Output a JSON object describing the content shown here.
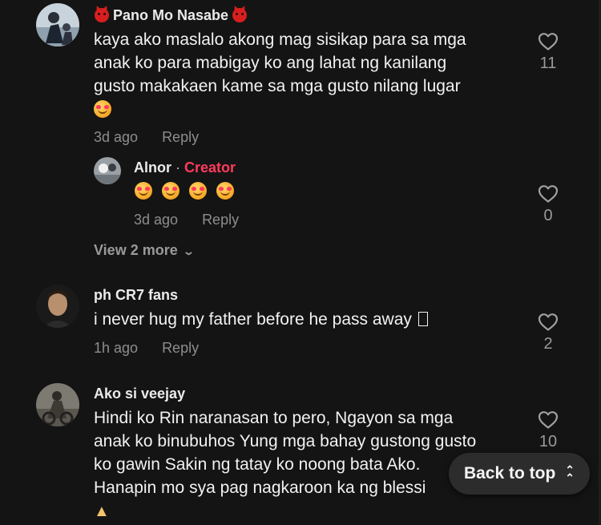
{
  "comments": [
    {
      "username": "Pano Mo Nasabe",
      "text_lines": [
        "kaya ako maslalo akong mag sisikap para sa mga",
        "anak ko para mabigay ko ang lahat ng kanilang",
        "gusto makakaen kame sa mga gusto nilang lugar"
      ],
      "emoji": "smiling-face-with-hearts",
      "time": "3d ago",
      "reply_label": "Reply",
      "likes": "11"
    },
    {
      "username": "Alnor",
      "creator_separator": "·",
      "creator_label": "Creator",
      "emoji": "smiling-face-with-hearts x4",
      "time": "3d ago",
      "reply_label": "Reply",
      "likes": "0"
    },
    {
      "username": "ph CR7 fans",
      "text": "i never hug my father before he pass away",
      "time": "1h ago",
      "reply_label": "Reply",
      "likes": "2"
    },
    {
      "username": "Ako si veejay",
      "text_lines": [
        "Hindi ko Rin naranasan to pero, Ngayon sa mga",
        "anak ko binubuhos Yung mga bahay gustong gusto",
        "ko gawin Sakin ng tatay ko noong bata Ako.",
        "Hanapin mo sya pag nagkaroon ka ng blessi"
      ],
      "emoji": "folded-hands",
      "likes": "10"
    }
  ],
  "view_more": "View 2 more",
  "back_to_top": "Back to top",
  "colors": {
    "background": "#141414",
    "creator": "#ff3b5c",
    "meta": "#8d8d8d"
  }
}
